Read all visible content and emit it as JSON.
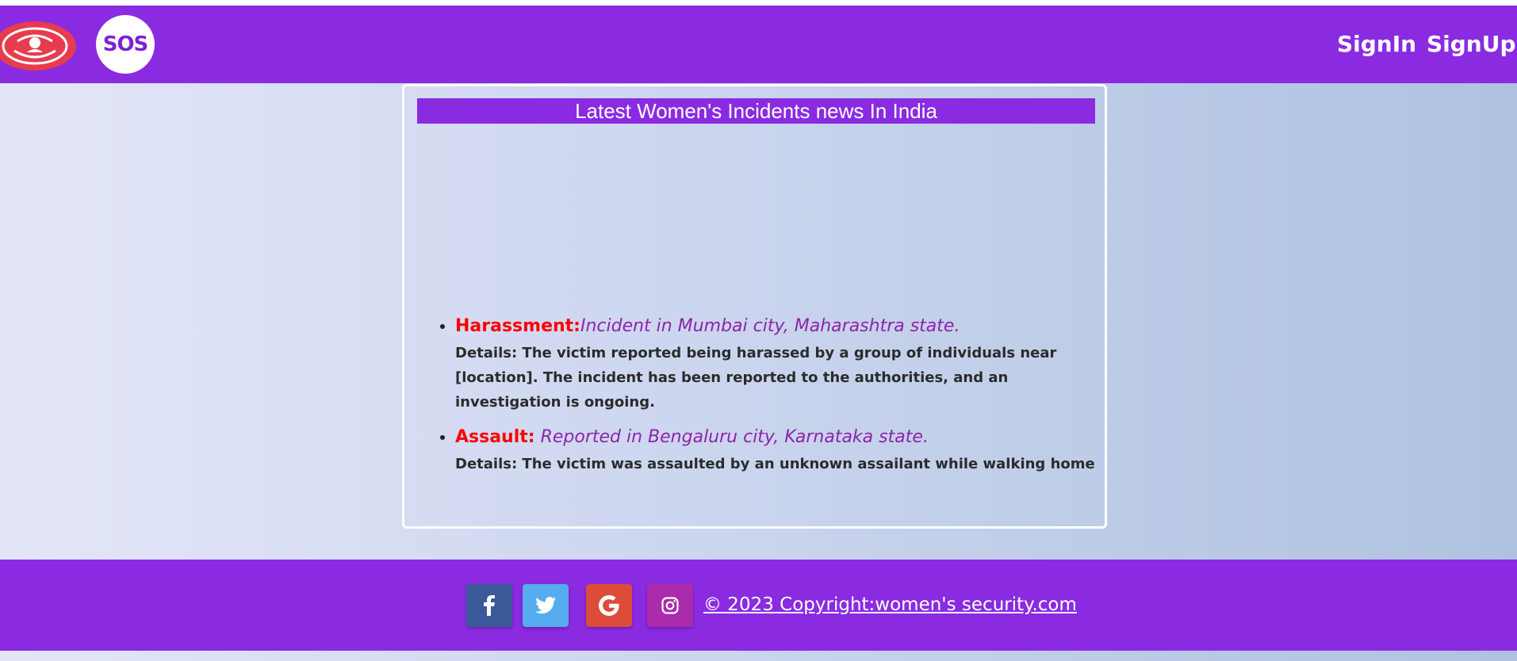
{
  "navbar": {
    "sos_label": "SOS",
    "signin_label": "SignIn",
    "signup_label": "SignUp"
  },
  "card": {
    "title": "Latest Women's Incidents news In India"
  },
  "news": [
    {
      "category": "Harassment:",
      "location": "Incident in Mumbai city, Maharashtra state.",
      "details": "Details: The victim reported being harassed by a group of individuals near [location]. The incident has been reported to the authorities, and an investigation is ongoing."
    },
    {
      "category": "Assault:",
      "location": " Reported in Bengaluru city, Karnataka state.",
      "details": "Details: The victim was assaulted by an unknown assailant while walking home"
    }
  ],
  "footer": {
    "copyright": "© 2023 Copyright:women's security.com",
    "icons": [
      "facebook-icon",
      "twitter-icon",
      "google-icon",
      "instagram-icon"
    ]
  },
  "colors": {
    "brand_purple": "#8a2be2",
    "logo_red": "#e73c4e",
    "category_red": "#ff0000",
    "location_purple": "#8e24aa"
  }
}
